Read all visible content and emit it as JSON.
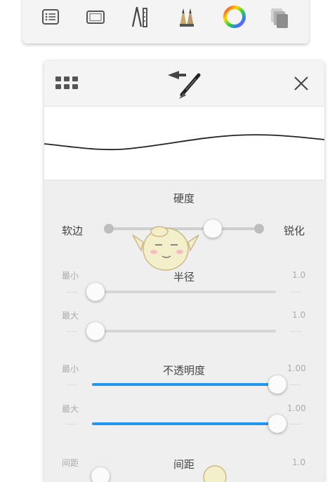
{
  "toolbar": {
    "icons": [
      "list-icon",
      "canvas-frame-icon",
      "ruler-pencil-icon",
      "brush-pair-icon",
      "color-wheel-icon",
      "layers-icon"
    ]
  },
  "panel": {
    "header_icons": [
      "grid-menu-icon",
      "brush-return-icon",
      "close-icon"
    ]
  },
  "hardness": {
    "title": "硬度",
    "left_label": "软边",
    "right_label": "锐化",
    "value_fraction": 0.69
  },
  "radius": {
    "title": "半径",
    "min_label": "最小",
    "min_value": "1.0",
    "max_label": "最大",
    "max_value": "1.0"
  },
  "opacity": {
    "title": "不透明度",
    "min_label": "最小",
    "min_value": "1.00",
    "max_label": "最大",
    "max_value": "1.00"
  },
  "spacing": {
    "title": "间距",
    "label": "间距",
    "value": "1.0"
  },
  "colors": {
    "accent": "#2196f3",
    "track": "#d6d6d6",
    "panel_bg": "#efefef"
  }
}
